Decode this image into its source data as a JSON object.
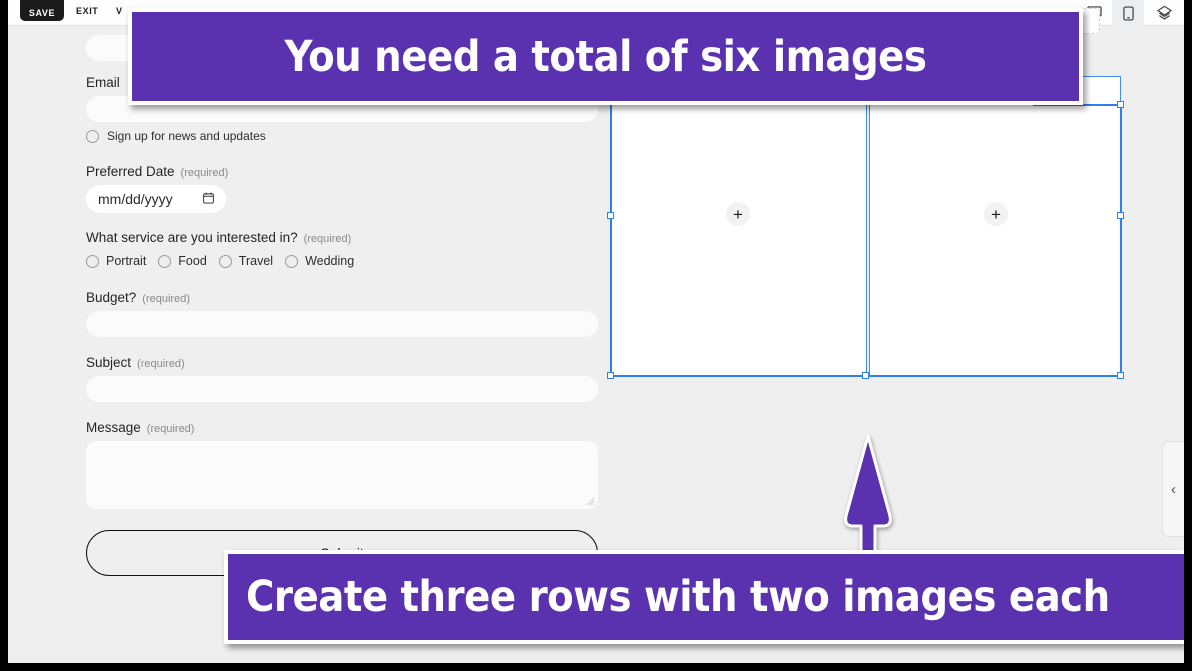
{
  "toolbar": {
    "save_label": "SAVE",
    "exit_label": "EXIT",
    "third_label": "V",
    "icons": {
      "desktop": "desktop-monitor-icon",
      "mobile": "mobile-phone-icon",
      "theme": "theme-diamond-icon"
    }
  },
  "form": {
    "email_label": "Email",
    "newsletter_label": "Sign up for news and updates",
    "date": {
      "label": "Preferred Date",
      "required": "(required)",
      "placeholder": "mm/dd/yyyy",
      "icon": "calendar-icon"
    },
    "service": {
      "label": "What service are you interested in?",
      "required": "(required)",
      "options": [
        "Portrait",
        "Food",
        "Travel",
        "Wedding"
      ]
    },
    "budget": {
      "label": "Budget?",
      "required": "(required)",
      "value": ""
    },
    "subject": {
      "label": "Subject",
      "required": "(required)",
      "value": ""
    },
    "message": {
      "label": "Message",
      "required": "(required)",
      "value": ""
    },
    "submit_label": "Submit"
  },
  "editor": {
    "add_image_glyph": "+",
    "collapse_panel_glyph": "‹"
  },
  "annotations": {
    "top_banner": "You need a total of six images",
    "bottom_banner": "Create three rows with two images each",
    "arrow": "up-arrow-annotation"
  },
  "colors": {
    "accent_purple": "#5a32b0",
    "selection_blue": "#3d8bfd",
    "canvas_gray": "#efefef",
    "toolbar_dark": "#1b1b1b"
  }
}
